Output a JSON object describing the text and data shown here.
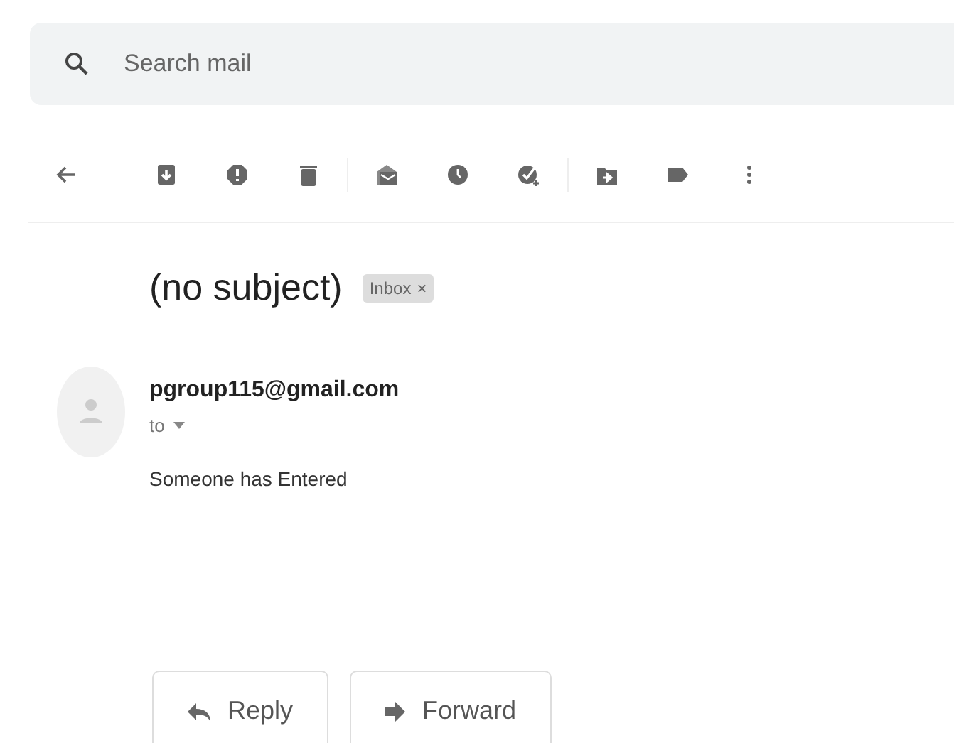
{
  "search": {
    "placeholder": "Search mail"
  },
  "message": {
    "subject": "(no subject)",
    "label": {
      "text": "Inbox",
      "remove": "×"
    },
    "sender": "pgroup115@gmail.com",
    "recipient": "to",
    "body": "Someone has Entered"
  },
  "actions": [
    {
      "kind": "reply",
      "label": "Reply"
    },
    {
      "kind": "forward",
      "label": "Forward"
    }
  ]
}
